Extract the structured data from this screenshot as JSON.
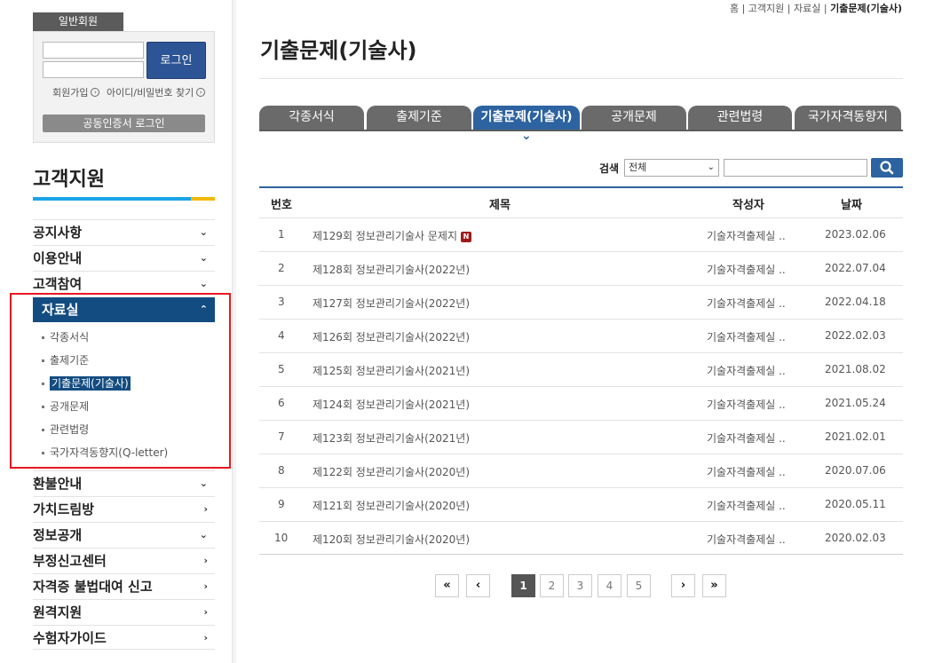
{
  "login": {
    "tag": "일반회원",
    "login_button": "로그인",
    "join_link": "회원가입",
    "find_link": "아이디/비밀번호 찾기",
    "cert_button": "공동인증서 로그인"
  },
  "sidebar": {
    "title": "고객지원",
    "menu_top": [
      {
        "label": "공지사항",
        "arrow": "⌄"
      },
      {
        "label": "이용안내",
        "arrow": "⌄"
      },
      {
        "label": "고객참여",
        "arrow": "⌄"
      }
    ],
    "active": {
      "label": "자료실",
      "arrow": "⌃"
    },
    "sub_items": [
      "각종서식",
      "출제기준",
      "기출문제(기술사)",
      "공개문제",
      "관련법령",
      "국가자격동향지(Q-letter)"
    ],
    "menu_bottom": [
      {
        "label": "환불안내",
        "arrow": "⌄"
      },
      {
        "label": "가치드림방",
        "arrow": "›"
      },
      {
        "label": "정보공개",
        "arrow": "⌄"
      },
      {
        "label": "부정신고센터",
        "arrow": "›"
      },
      {
        "label": "자격증 불법대여 신고",
        "arrow": "›"
      },
      {
        "label": "원격지원",
        "arrow": "›"
      },
      {
        "label": "수험자가이드",
        "arrow": "›"
      }
    ]
  },
  "breadcrumb": {
    "home": "홈",
    "sep": "|",
    "level1": "고객지원",
    "level2": "자료실",
    "current": "기출문제(기술사)"
  },
  "page_title": "기출문제(기술사)",
  "tabs": [
    "각종서식",
    "출제기준",
    "기출문제(기술사)",
    "공개문제",
    "관련법령",
    "국가자격동향지"
  ],
  "search": {
    "label": "검색",
    "selected": "전체",
    "query": ""
  },
  "table": {
    "headers": {
      "no": "번호",
      "title": "제목",
      "author": "작성자",
      "date": "날짜"
    },
    "new_badge": "N",
    "rows": [
      {
        "no": "1",
        "title": "제129회 정보관리기술사 문제지",
        "author": "기술자격출제실 ..",
        "date": "2023.02.06",
        "is_new": true
      },
      {
        "no": "2",
        "title": "제128회 정보관리기술사(2022년)",
        "author": "기술자격출제실 ..",
        "date": "2022.07.04"
      },
      {
        "no": "3",
        "title": "제127회 정보관리기술사(2022년)",
        "author": "기술자격출제실 ..",
        "date": "2022.04.18"
      },
      {
        "no": "4",
        "title": "제126회 정보관리기술사(2022년)",
        "author": "기술자격출제실 ..",
        "date": "2022.02.03"
      },
      {
        "no": "5",
        "title": "제125회 정보관리기술사(2021년)",
        "author": "기술자격출제실 ..",
        "date": "2021.08.02"
      },
      {
        "no": "6",
        "title": "제124회 정보관리기술사(2021년)",
        "author": "기술자격출제실 ..",
        "date": "2021.05.24"
      },
      {
        "no": "7",
        "title": "제123회 정보관리기술사(2021년)",
        "author": "기술자격출제실 ..",
        "date": "2021.02.01"
      },
      {
        "no": "8",
        "title": "제122회 정보관리기술사(2020년)",
        "author": "기술자격출제실 ..",
        "date": "2020.07.06"
      },
      {
        "no": "9",
        "title": "제121회 정보관리기술사(2020년)",
        "author": "기술자격출제실 ..",
        "date": "2020.05.11"
      },
      {
        "no": "10",
        "title": "제120회 정보관리기술사(2020년)",
        "author": "기술자격출제실 ..",
        "date": "2020.02.03"
      }
    ]
  },
  "pagination": {
    "first": "«",
    "prev": "‹",
    "pages": [
      "1",
      "2",
      "3",
      "4",
      "5"
    ],
    "current": "1",
    "next": "›",
    "last": "»"
  },
  "colors": {
    "brand_blue": "#134c80",
    "tab_active": "#2d63a0",
    "tab_inactive": "#6a6a6a",
    "highlight_box": "#e8171f",
    "accent_cyan": "#1aa3e8",
    "accent_yellow": "#f2b800"
  }
}
